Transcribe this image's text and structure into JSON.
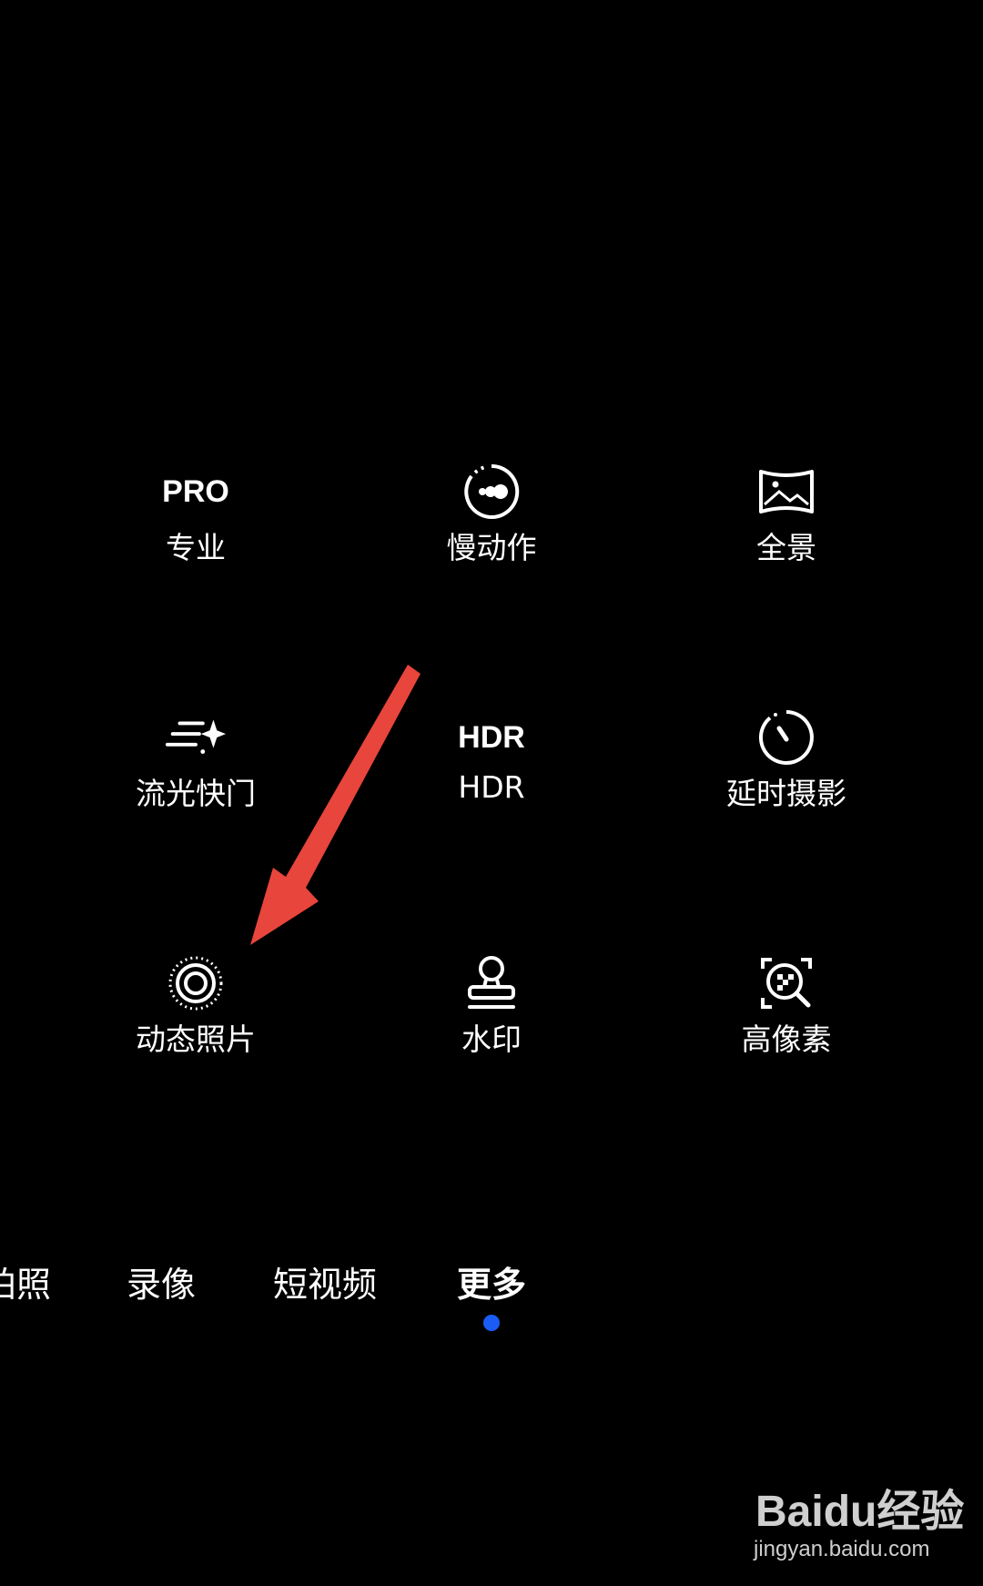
{
  "modes": [
    {
      "name": "pro",
      "icon": "pro-text-icon",
      "icon_text": "PRO",
      "label": "专业"
    },
    {
      "name": "slow-motion",
      "icon": "slow-motion-icon",
      "label": "慢动作"
    },
    {
      "name": "panorama",
      "icon": "panorama-icon",
      "label": "全景"
    },
    {
      "name": "light-painting",
      "icon": "light-streak-icon",
      "label": "流光快门"
    },
    {
      "name": "hdr",
      "icon": "hdr-text-icon",
      "icon_text": "HDR",
      "label": "HDR"
    },
    {
      "name": "time-lapse",
      "icon": "timer-icon",
      "label": "延时摄影"
    },
    {
      "name": "moving-picture",
      "icon": "moving-picture-icon",
      "label": "动态照片"
    },
    {
      "name": "watermark",
      "icon": "stamp-icon",
      "label": "水印"
    },
    {
      "name": "high-res",
      "icon": "high-res-icon",
      "label": "高像素"
    }
  ],
  "tabs": [
    "拍照",
    "录像",
    "短视频",
    "更多"
  ],
  "active_tab": "更多",
  "colors": {
    "background": "#000000",
    "text": "#ffffff",
    "active_dot": "#1a5cf5",
    "annotation_arrow": "#e8453c"
  },
  "watermark": {
    "logo": "Baidu经验",
    "url": "jingyan.baidu.com"
  }
}
